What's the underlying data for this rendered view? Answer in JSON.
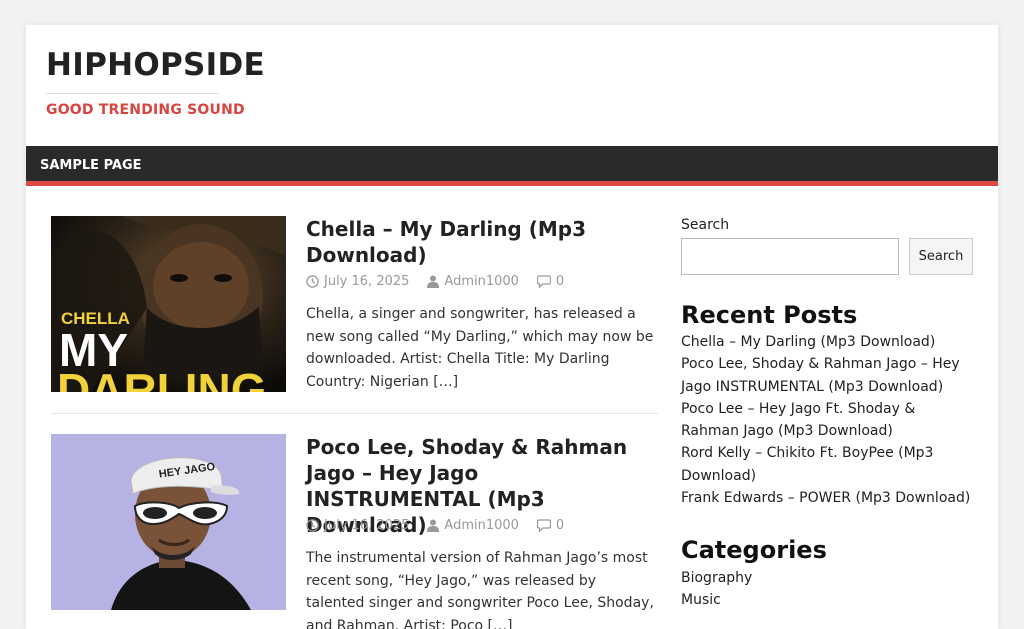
{
  "site": {
    "title": "HIPHOPSIDE",
    "tagline": "GOOD TRENDING SOUND"
  },
  "nav": {
    "items": [
      {
        "label": "SAMPLE PAGE"
      }
    ]
  },
  "posts": [
    {
      "title": "Chella – My Darling (Mp3 Download)",
      "date": "July 16, 2025",
      "author": "Admin1000",
      "comments": "0",
      "excerpt": "Chella, a singer and songwriter, has released a new song called “My Darling,” which may now be downloaded. Artist: Chella Title: My Darling Country: Nigerian",
      "more": "[…]",
      "thumb_text": [
        "CHELLA",
        "MY",
        "DARLING"
      ]
    },
    {
      "title": "Poco Lee, Shoday & Rahman Jago – Hey Jago INSTRUMENTAL (Mp3 Download)",
      "date": "July 16, 2025",
      "author": "Admin1000",
      "comments": "0",
      "excerpt": "The instrumental version of Rahman Jago’s most recent song, “Hey Jago,” was released by talented singer and songwriter Poco Lee, Shoday, and Rahman. Artist: Poco",
      "more": "[…]",
      "thumb_text": [
        "HEY JAGO"
      ]
    }
  ],
  "sidebar": {
    "search": {
      "label": "Search",
      "button": "Search",
      "placeholder": ""
    },
    "recent_posts": {
      "title": "Recent Posts",
      "items": [
        "Chella – My Darling (Mp3 Download)",
        "Poco Lee, Shoday & Rahman Jago – Hey Jago INSTRUMENTAL (Mp3 Download)",
        "Poco Lee – Hey Jago Ft. Shoday & Rahman Jago (Mp3 Download)",
        "Rord Kelly – Chikito Ft. BoyPee (Mp3 Download)",
        "Frank Edwards – POWER (Mp3 Download)"
      ]
    },
    "categories": {
      "title": "Categories",
      "items": [
        "Biography",
        "Music"
      ]
    }
  },
  "colors": {
    "accent": "#e04a44",
    "nav_bg": "#2a2a2a",
    "tagline": "#d8443f"
  },
  "icons": {
    "date": "clock-icon",
    "author": "user-icon",
    "comments": "comment-icon"
  }
}
